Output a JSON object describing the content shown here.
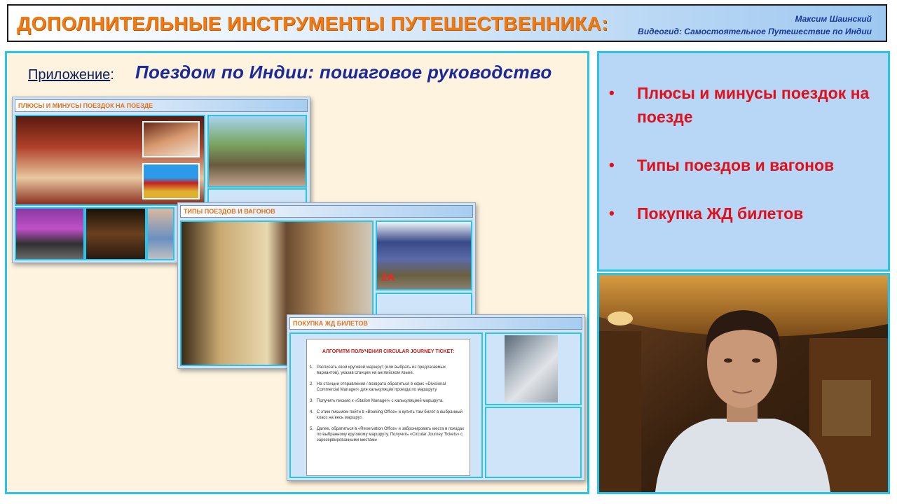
{
  "header": {
    "title": "ДОПОЛНИТЕЛЬНЫЕ ИНСТРУМЕНТЫ ПУТЕШЕСТВЕННИКА:",
    "author": "Максим Шаинский",
    "subtitle": "Видеогид: Самостоятельное Путешествие по Индии"
  },
  "main": {
    "app_label": "Приложение",
    "app_title": "Поездом по Индии: пошаговое руководство"
  },
  "thumbs": [
    {
      "title": "ПЛЮСЫ И МИНУСЫ ПОЕЗДОК НА ПОЕЗДЕ"
    },
    {
      "title": "ТИПЫ ПОЕЗДОВ И ВАГОНОВ",
      "badge": "2A"
    },
    {
      "title": "ПОКУПКА ЖД БИЛЕТОВ",
      "algo_title": "АЛГОРИТМ ПОЛУЧЕНИЯ CIRCULAR JOURNEY TICKET:",
      "steps": [
        "Расписать свой круговой маршрут (или выбрать из предлагаемых вариантов), указав станции на английском языке.",
        "На станции отправления / возврата обратиться в офис «Divisional Commercial Manager» для калькуляции проезда по маршруту",
        "Получить письмо к «Station Manager» с калькуляцией маршрута.",
        "С этим письмом пойти в «Booking Office» и купить там билет в выбранный класс на весь маршрут.",
        "Далее, обратиться в «Reservation Office» и забронировать места в поездах по выбранному круговому маршруту. Получить «Circular Journey Tickets» с зарезервированными местами"
      ]
    }
  ],
  "bullets": [
    "Плюсы и минусы поездок на поезде",
    "Типы поездов и вагонов",
    "Покупка ЖД билетов"
  ],
  "colors": {
    "accent_border": "#29c4ec",
    "header_title": "#ee7a14",
    "bullet_text": "#e0101a",
    "right_panel_bg": "#b8d7f7",
    "left_panel_bg": "#fdf3df"
  }
}
